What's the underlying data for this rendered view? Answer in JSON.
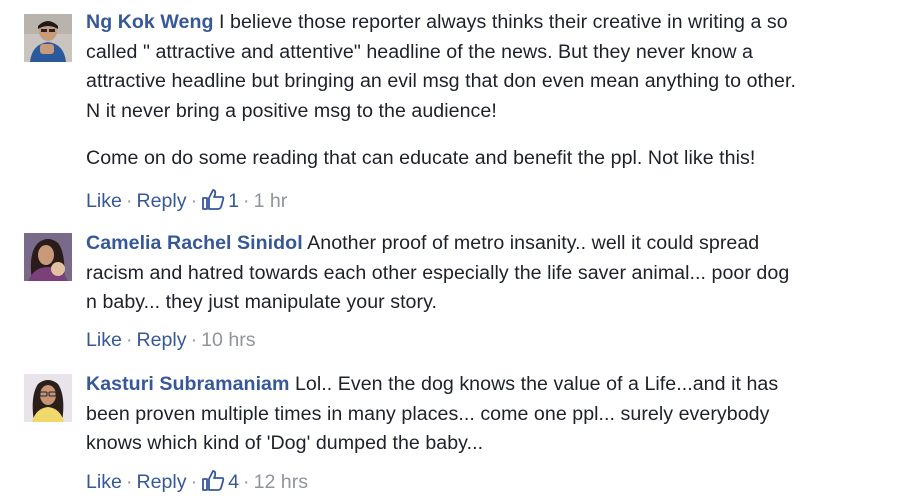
{
  "comments": [
    {
      "name": "Ng Kok Weng",
      "lines": [
        "I believe those reporter always thinks their creative in writing a so",
        "called \" attractive and attentive\" headline of the news. But they never know a",
        "attractive headline but bringing an evil msg that don even mean anything to other.",
        "N it never bring a positive msg to the audience!"
      ],
      "paragraph2": "Come on do some reading that can educate and benefit the ppl. Not like this!",
      "like_label": "Like",
      "reply_label": "Reply",
      "reaction_count": "1",
      "time": "1 hr"
    },
    {
      "name": "Camelia Rachel Sinidol",
      "lines": [
        "Another proof of metro insanity.. well it could spread",
        "racism and hatred towards each other especially the life saver animal... poor dog",
        "n baby... they just manipulate your story."
      ],
      "like_label": "Like",
      "reply_label": "Reply",
      "time": "10 hrs"
    },
    {
      "name": "Kasturi Subramaniam",
      "lines": [
        "Lol.. Even the dog knows the value of a Life...and it has",
        "been proven multiple times in many places... come one ppl... surely everybody",
        "knows which kind of 'Dog' dumped the baby..."
      ],
      "like_label": "Like",
      "reply_label": "Reply",
      "reaction_count": "4",
      "time": "12 hrs"
    }
  ],
  "colors": {
    "link": "#365899",
    "meta": "#90949c",
    "text": "#1d2129"
  },
  "icons": {
    "reaction": "thumbs-up-icon",
    "separator": "middle-dot"
  }
}
